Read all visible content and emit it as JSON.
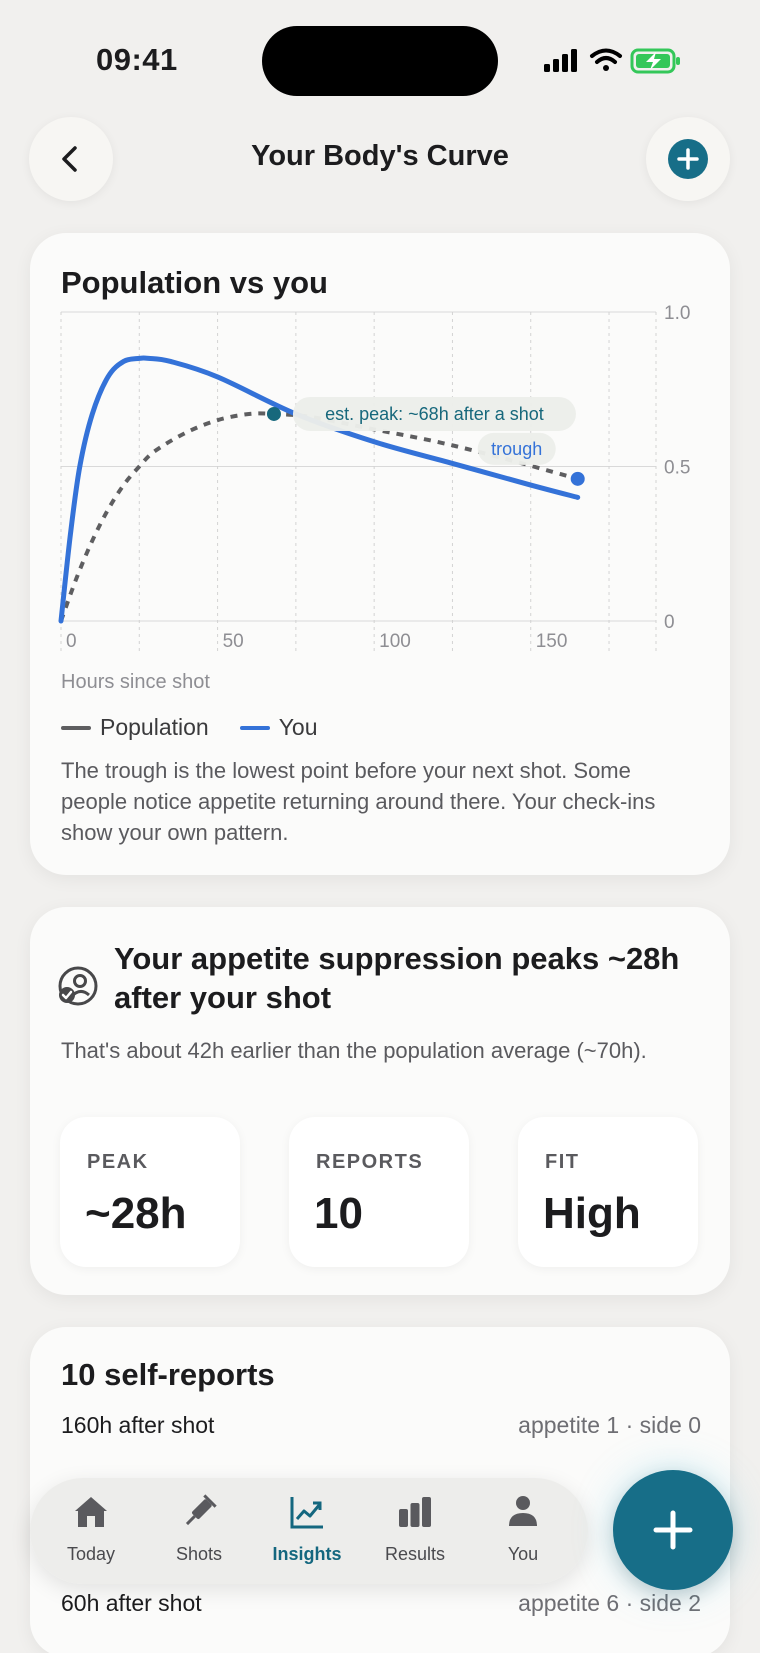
{
  "status_bar": {
    "time": "09:41"
  },
  "nav": {
    "title": "Your Body's Curve"
  },
  "chart_card": {
    "title": "Population vs you",
    "x_axis_label": "Hours since shot",
    "legend": {
      "population": "Population",
      "you": "You"
    },
    "annotations": {
      "peak": "est. peak: ~68h after a shot",
      "trough": "trough"
    },
    "description": "The trough is the lowest point before your next shot. Some people notice appetite returning around there. Your check-ins show your own pattern.",
    "colors": {
      "you": "#3472d8",
      "population": "#5e5e60",
      "peak_marker": "#17687c"
    }
  },
  "chart_data": {
    "type": "line",
    "title": "Population vs you",
    "xlabel": "Hours since shot",
    "ylabel": "",
    "xlim": [
      0,
      190
    ],
    "ylim": [
      0,
      1.0
    ],
    "x_ticks": [
      "0",
      "50",
      "100",
      "150"
    ],
    "y_ticks": [
      "1.0",
      "0.5",
      "0"
    ],
    "legend_position": "bottom-left",
    "series": [
      {
        "name": "Population",
        "style": "dashed",
        "x": [
          0,
          5,
          10,
          15,
          20,
          25,
          30,
          40,
          50,
          60,
          68,
          80,
          100,
          120,
          140,
          165
        ],
        "y": [
          0,
          0.14,
          0.26,
          0.36,
          0.44,
          0.5,
          0.55,
          0.61,
          0.65,
          0.67,
          0.67,
          0.66,
          0.62,
          0.58,
          0.53,
          0.46
        ]
      },
      {
        "name": "You",
        "style": "solid",
        "x": [
          0,
          3,
          6,
          10,
          15,
          20,
          25,
          28,
          35,
          50,
          75,
          100,
          125,
          150,
          165
        ],
        "y": [
          0,
          0.28,
          0.5,
          0.67,
          0.79,
          0.84,
          0.85,
          0.85,
          0.84,
          0.79,
          0.67,
          0.58,
          0.51,
          0.44,
          0.4
        ]
      }
    ],
    "points": [
      {
        "label": "est. peak: ~68h after a shot",
        "x": 68,
        "y": 0.67
      },
      {
        "label": "trough",
        "x": 165,
        "y": 0.46
      }
    ]
  },
  "insight_card": {
    "title": "Your appetite suppression peaks ~28h after your shot",
    "description": "That's about 42h earlier than the population average (~70h).",
    "stats": [
      {
        "label": "PEAK",
        "value": "~28h"
      },
      {
        "label": "REPORTS",
        "value": "10"
      },
      {
        "label": "FIT",
        "value": "High"
      }
    ]
  },
  "reports_card": {
    "title": "10 self-reports",
    "rows": [
      {
        "when": "160h after shot",
        "values": "appetite 1 · side 0"
      },
      {
        "when": "60h after shot",
        "values": "appetite 6 · side 2"
      }
    ]
  },
  "tabbar": {
    "tabs": [
      {
        "label": "Today",
        "icon": "house-icon"
      },
      {
        "label": "Shots",
        "icon": "syringe-icon"
      },
      {
        "label": "Insights",
        "icon": "trend-chart-icon",
        "active": true
      },
      {
        "label": "Results",
        "icon": "bar-chart-icon"
      },
      {
        "label": "You",
        "icon": "person-icon"
      }
    ]
  },
  "colors": {
    "accent": "#176e88",
    "background": "#f1f0ee",
    "card": "#fbfbfa"
  }
}
